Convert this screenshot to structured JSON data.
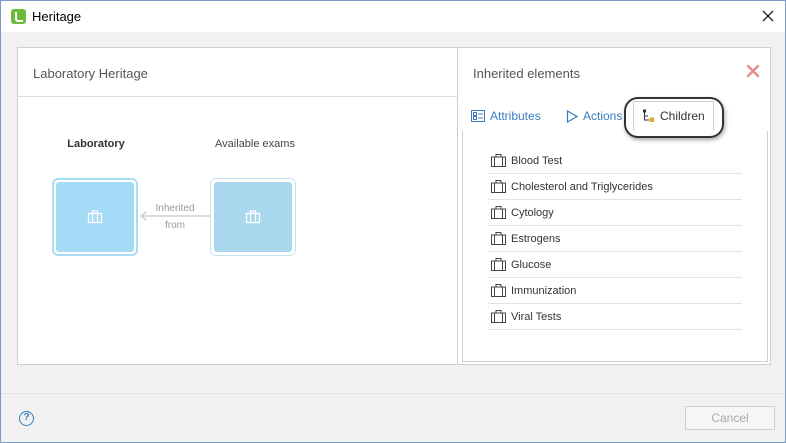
{
  "window": {
    "title": "Heritage"
  },
  "left_panel": {
    "title": "Laboratory Heritage",
    "source_node_label": "Laboratory",
    "target_node_label": "Available exams",
    "arrow_label_line1": "Inherited",
    "arrow_label_line2": "from",
    "node_icon": "briefcase-icon"
  },
  "right_panel": {
    "title": "Inherited elements",
    "tabs": [
      {
        "label": "Attributes",
        "icon": "attributes-icon"
      },
      {
        "label": "Actions",
        "icon": "play-icon"
      },
      {
        "label": "Children",
        "icon": "hierarchy-icon",
        "active": true
      }
    ],
    "children": [
      "Blood Test",
      "Cholesterol and Triglycerides",
      "Cytology",
      "Estrogens",
      "Glucose",
      "Immunization",
      "Viral Tests"
    ]
  },
  "footer": {
    "help_label": "?",
    "cancel_label": "Cancel"
  },
  "colors": {
    "accent": "#3a7bbf",
    "node_fill": "#a4dcf7",
    "close_red": "#e88a8a",
    "app_green": "#6dbb3c"
  }
}
